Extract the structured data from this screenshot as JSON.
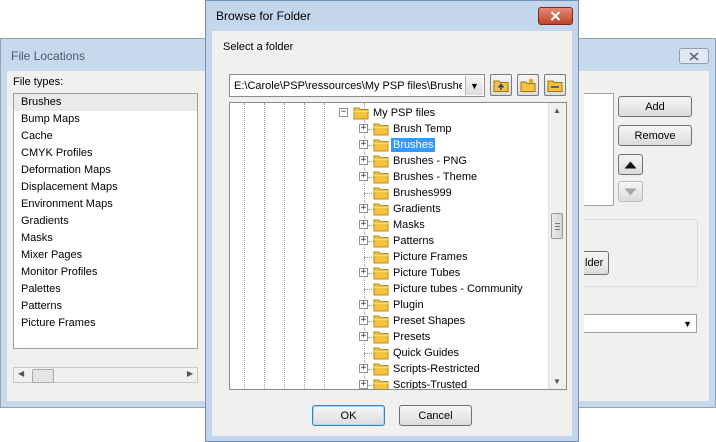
{
  "file_locations": {
    "title": "File Locations",
    "file_types_label": "File types:",
    "file_types": [
      "Brushes",
      "Bump Maps",
      "Cache",
      "CMYK Profiles",
      "Deformation Maps",
      "Displacement Maps",
      "Environment Maps",
      "Gradients",
      "Masks",
      "Mixer Pages",
      "Monitor Profiles",
      "Palettes",
      "Patterns",
      "Picture Frames"
    ],
    "add_label": "Add",
    "remove_label": "Remove",
    "folder_button_fragment": "lder"
  },
  "browse_dialog": {
    "title": "Browse for Folder",
    "prompt": "Select a folder",
    "path": "E:\\Carole\\PSP\\ressources\\My PSP files\\Brushes",
    "root_folder": "My PSP files",
    "folders": [
      "Brush Temp",
      "Brushes",
      "Brushes - PNG",
      "Brushes - Theme",
      "Brushes999",
      "Gradients",
      "Masks",
      "Patterns",
      "Picture Frames",
      "Picture Tubes",
      "Picture tubes - Community",
      "Plugin",
      "Preset Shapes",
      "Presets",
      "Quick Guides",
      "Scripts-Restricted",
      "Scripts-Trusted"
    ],
    "selected_folder": "Brushes",
    "ok_label": "OK",
    "cancel_label": "Cancel"
  },
  "icons": [
    "close-icon",
    "up-one-level-icon",
    "new-folder-icon",
    "browse-folder-icon",
    "folder-icon",
    "expand-icon",
    "arrow-up-icon",
    "arrow-down-icon"
  ],
  "colors": {
    "selection": "#3399ff",
    "title_bar": "#c4d6ec",
    "close_button": "#c2422a",
    "folder": "#f4c23f"
  }
}
